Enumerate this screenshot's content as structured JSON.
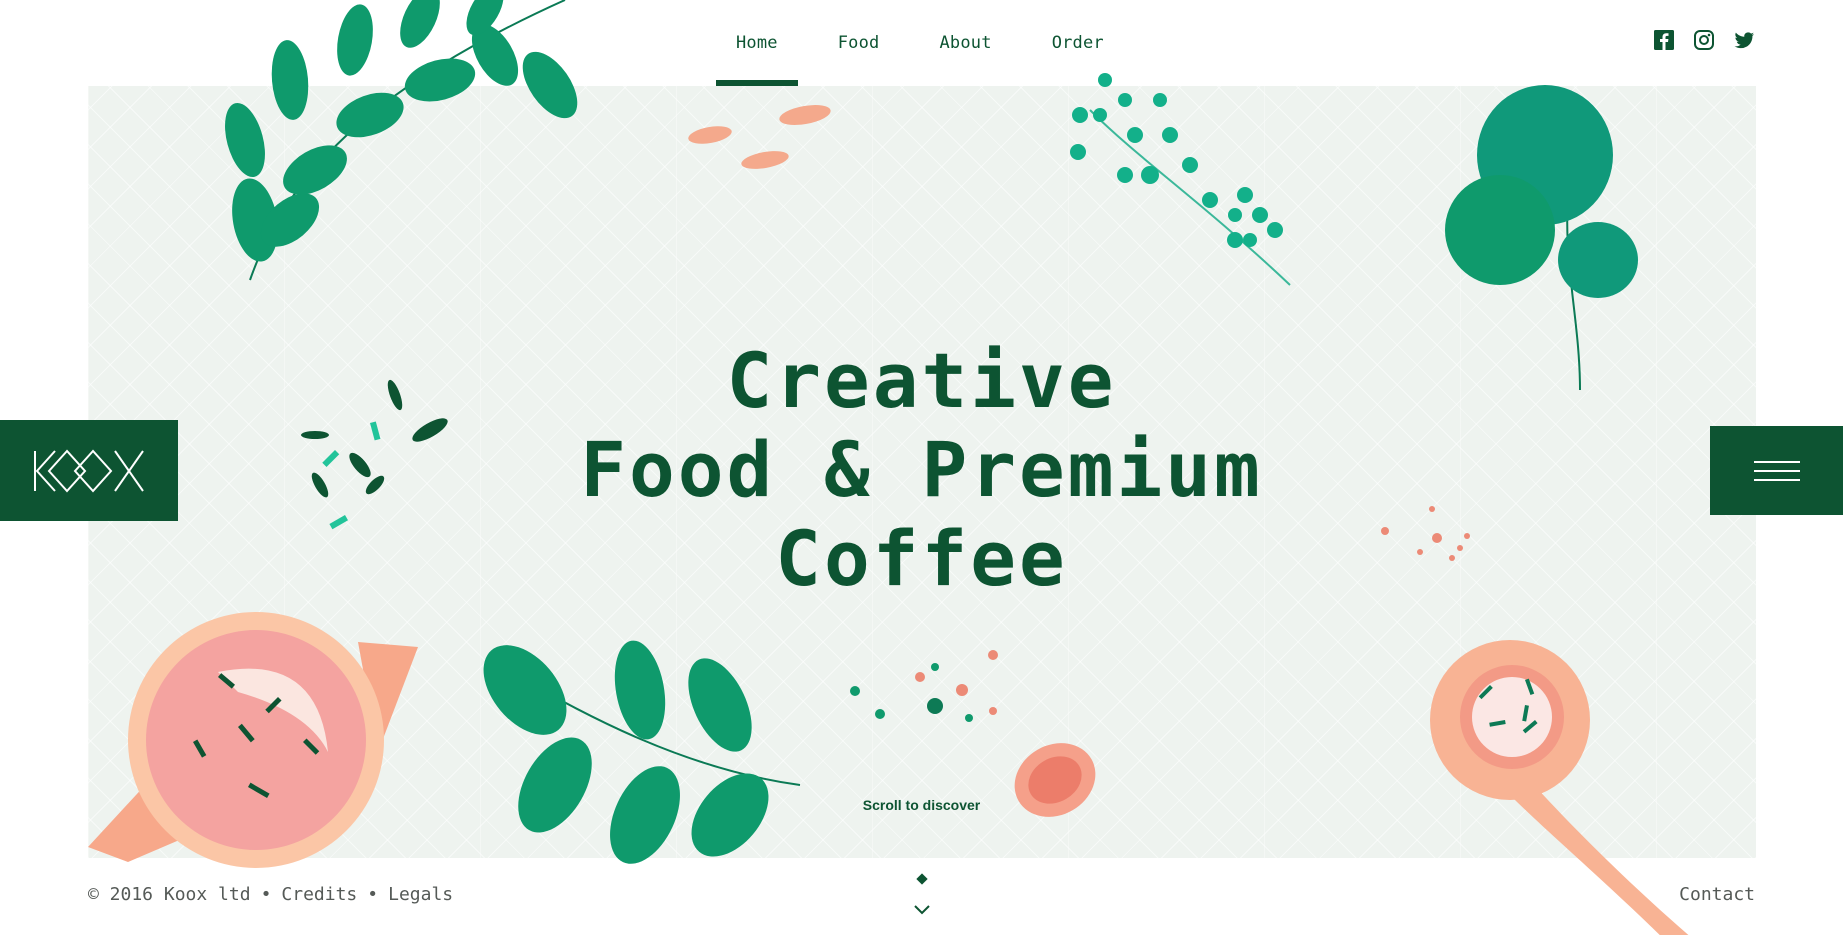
{
  "nav": {
    "items": [
      {
        "label": "Home",
        "active": true
      },
      {
        "label": "Food",
        "active": false
      },
      {
        "label": "About",
        "active": false
      },
      {
        "label": "Order",
        "active": false
      }
    ]
  },
  "social": {
    "icons": [
      "facebook-icon",
      "instagram-icon",
      "twitter-icon"
    ]
  },
  "brand": {
    "logo_text": "KOOX"
  },
  "hero": {
    "headline_lines": [
      "Creative",
      "Food & Premium",
      "Coffee"
    ],
    "scroll_text": "Scroll to discover"
  },
  "footer": {
    "copyright": "© 2016 Koox ltd",
    "sep1": "•",
    "credits": "Credits",
    "sep2": "•",
    "legals": "Legals",
    "contact": "Contact"
  },
  "colors": {
    "primary": "#0d5432",
    "leaf": "#0f9a6c",
    "panel": "#eef3ef",
    "peach": "#f4a98c",
    "text_muted": "#555a57"
  }
}
